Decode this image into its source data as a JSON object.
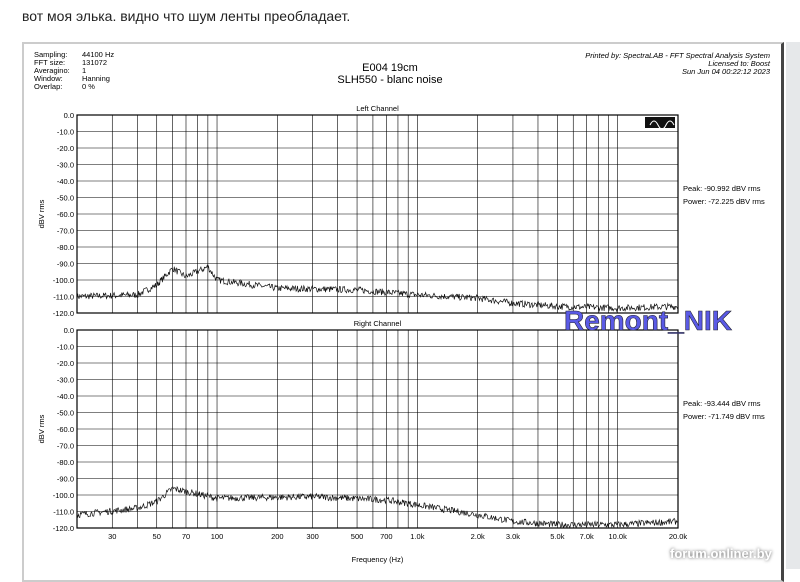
{
  "post_text": "вот моя элька. видно что шум ленты преобладает.",
  "info": {
    "labels": [
      "Sampling:",
      "FFT size:",
      "Averagino:",
      "Window:",
      "Overlap:"
    ],
    "values": [
      "44100 Hz",
      "131072",
      "1",
      "Hanning",
      "0 %"
    ]
  },
  "printed": [
    "Printed by: SpectraLAB - FFT Spectral Analysis System",
    "Licensed to: Boost",
    "Sun Jun 04 00:22:12 2023"
  ],
  "watermark_center": "Remont_NIK",
  "watermark_site": "forum.onliner.by",
  "chart_data": [
    {
      "type": "line",
      "title": "E004  19cm",
      "subtitle": "SLH550 - blanc noise",
      "channel": "Left Channel",
      "xlabel": "Frequency (Hz)",
      "ylabel": "dBV rms",
      "xscale": "log",
      "xlim": [
        20,
        20000
      ],
      "ylim": [
        -120,
        0
      ],
      "yticks": [
        0,
        -10,
        -20,
        -30,
        -40,
        -50,
        -60,
        -70,
        -80,
        -90,
        -100,
        -110,
        -120
      ],
      "ytick_labels": [
        "0.0",
        "-10.0",
        "-20.0",
        "-30.0",
        "-40.0",
        "-50.0",
        "-60.0",
        "-70.0",
        "-80.0",
        "-90.0",
        "-100.0",
        "-110.0",
        "-120.0"
      ],
      "annotations": [
        "Peak: -90.992 dBV rms",
        "Power: -72.225 dBV rms"
      ],
      "points": [
        [
          20,
          -110
        ],
        [
          40,
          -109
        ],
        [
          50,
          -103
        ],
        [
          60,
          -93
        ],
        [
          70,
          -98
        ],
        [
          90,
          -92
        ],
        [
          100,
          -100
        ],
        [
          200,
          -105
        ],
        [
          500,
          -106
        ],
        [
          1000,
          -109
        ],
        [
          2000,
          -111
        ],
        [
          3000,
          -114
        ],
        [
          5000,
          -116
        ],
        [
          10000,
          -117
        ],
        [
          20000,
          -116
        ]
      ]
    },
    {
      "type": "line",
      "channel": "Right Channel",
      "xlabel": "Frequency (Hz)",
      "ylabel": "dBV rms",
      "xscale": "log",
      "xlim": [
        20,
        20000
      ],
      "ylim": [
        -120,
        0
      ],
      "yticks": [
        0,
        -10,
        -20,
        -30,
        -40,
        -50,
        -60,
        -70,
        -80,
        -90,
        -100,
        -110,
        -120
      ],
      "ytick_labels": [
        "0.0",
        "-10.0",
        "-20.0",
        "-30.0",
        "-40.0",
        "-50.0",
        "-60.0",
        "-70.0",
        "-80.0",
        "-90.0",
        "-100.0",
        "-110.0",
        "-120.0"
      ],
      "xticks": [
        30,
        50,
        70,
        100,
        200,
        300,
        500,
        700,
        1000,
        2000,
        3000,
        5000,
        7000,
        10000,
        20000
      ],
      "xtick_labels": [
        "30",
        "50",
        "70",
        "100",
        "200",
        "300",
        "500",
        "700",
        "1.0k",
        "2.0k",
        "3.0k",
        "5.0k",
        "7.0k",
        "10.0k",
        "20.0k"
      ],
      "annotations": [
        "Peak: -93.444 dBV rms",
        "Power: -71.749 dBV rms"
      ],
      "points": [
        [
          20,
          -112
        ],
        [
          40,
          -108
        ],
        [
          50,
          -104
        ],
        [
          60,
          -96
        ],
        [
          100,
          -102
        ],
        [
          300,
          -101
        ],
        [
          700,
          -103
        ],
        [
          1000,
          -106
        ],
        [
          2000,
          -112
        ],
        [
          3000,
          -116
        ],
        [
          5000,
          -118
        ],
        [
          10000,
          -118
        ],
        [
          20000,
          -116
        ]
      ]
    }
  ]
}
